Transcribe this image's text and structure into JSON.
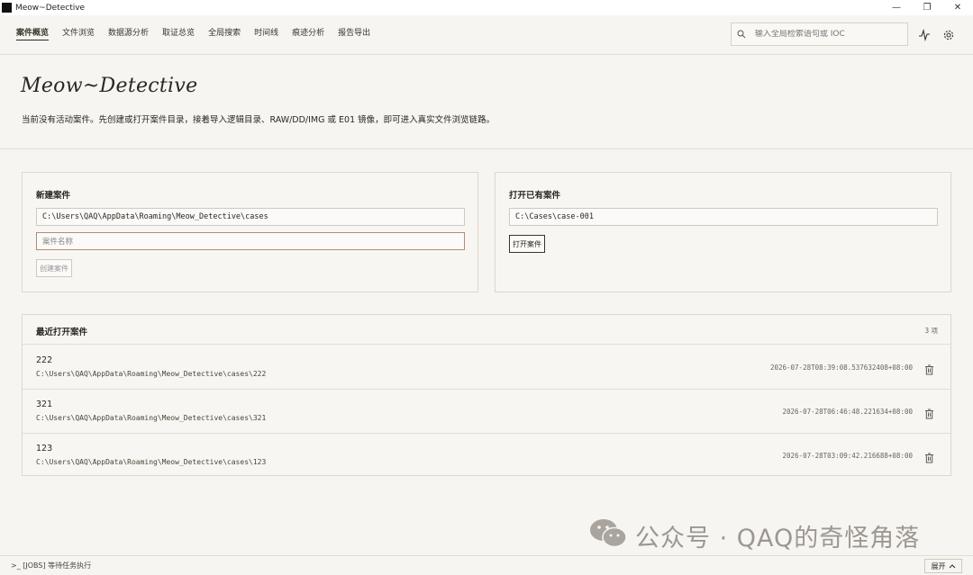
{
  "window": {
    "title": "Meow~Detective",
    "controls": [
      "—",
      "❐",
      "✕"
    ]
  },
  "nav": {
    "tabs": [
      "案件概览",
      "文件浏览",
      "数据源分析",
      "取证总览",
      "全局搜索",
      "时间线",
      "痕迹分析",
      "报告导出"
    ],
    "active_index": 0,
    "search_placeholder": "输入全局检索语句或 IOC"
  },
  "hero": {
    "brand": "Meow~Detective",
    "description": "当前没有活动案件。先创建或打开案件目录，接着导入逻辑目录、RAW/DD/IMG 或 E01 镜像，即可进入真实文件浏览链路。"
  },
  "new_case": {
    "title": "新建案件",
    "path_value": "C:\\Users\\QAQ\\AppData\\Roaming\\Meow_Detective\\cases",
    "name_placeholder": "案件名称",
    "create_label": "创建案件"
  },
  "open_case": {
    "title": "打开已有案件",
    "path_value": "C:\\Cases\\case-001",
    "open_label": "打开案件"
  },
  "recent": {
    "title": "最近打开案件",
    "count_label": "3 项",
    "items": [
      {
        "name": "222",
        "path": "C:\\Users\\QAQ\\AppData\\Roaming\\Meow_Detective\\cases\\222",
        "time": "2026-07-28T08:39:08.537632408+08:00"
      },
      {
        "name": "321",
        "path": "C:\\Users\\QAQ\\AppData\\Roaming\\Meow_Detective\\cases\\321",
        "time": "2026-07-28T06:46:48.221634+08:00"
      },
      {
        "name": "123",
        "path": "C:\\Users\\QAQ\\AppData\\Roaming\\Meow_Detective\\cases\\123",
        "time": "2026-07-28T03:09:42.216688+08:00"
      }
    ]
  },
  "status": {
    "prefix": ">_",
    "jobs_text": "[JOBS] 等待任务执行",
    "expand_label": "展开"
  },
  "watermark": "公众号 · QAQ的奇怪角落",
  "colors": {
    "background": "#f7f5f1",
    "border": "#ddd7cc",
    "text": "#2b2620",
    "focus_border": "#b58b73"
  },
  "icons": [
    "app-icon",
    "search-icon",
    "activity-icon",
    "gear-icon",
    "trash-icon",
    "chevron-up-icon",
    "wechat-icon"
  ]
}
